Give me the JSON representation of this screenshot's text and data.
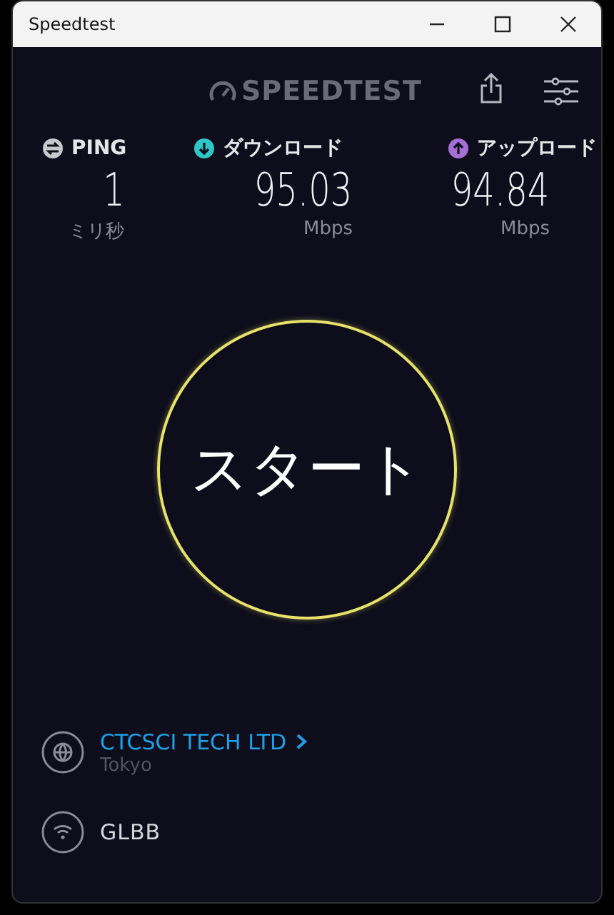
{
  "window": {
    "title": "Speedtest"
  },
  "header": {
    "logo": "SPEEDTEST"
  },
  "metrics": [
    {
      "kind": "ping",
      "label": "PING",
      "value": "1",
      "unit": "ミリ秒",
      "color": "#c8c8cc"
    },
    {
      "kind": "download",
      "label": "ダウンロード",
      "value": "95.03",
      "unit": "Mbps",
      "color": "#2fc6c6"
    },
    {
      "kind": "upload",
      "label": "アップロード",
      "value": "94.84",
      "unit": "Mbps",
      "color": "#a66fd6"
    }
  ],
  "start_button": {
    "label": "スタート"
  },
  "server": {
    "name": "CTCSCI TECH LTD",
    "location": "Tokyo"
  },
  "network": {
    "name": "GLBB"
  }
}
